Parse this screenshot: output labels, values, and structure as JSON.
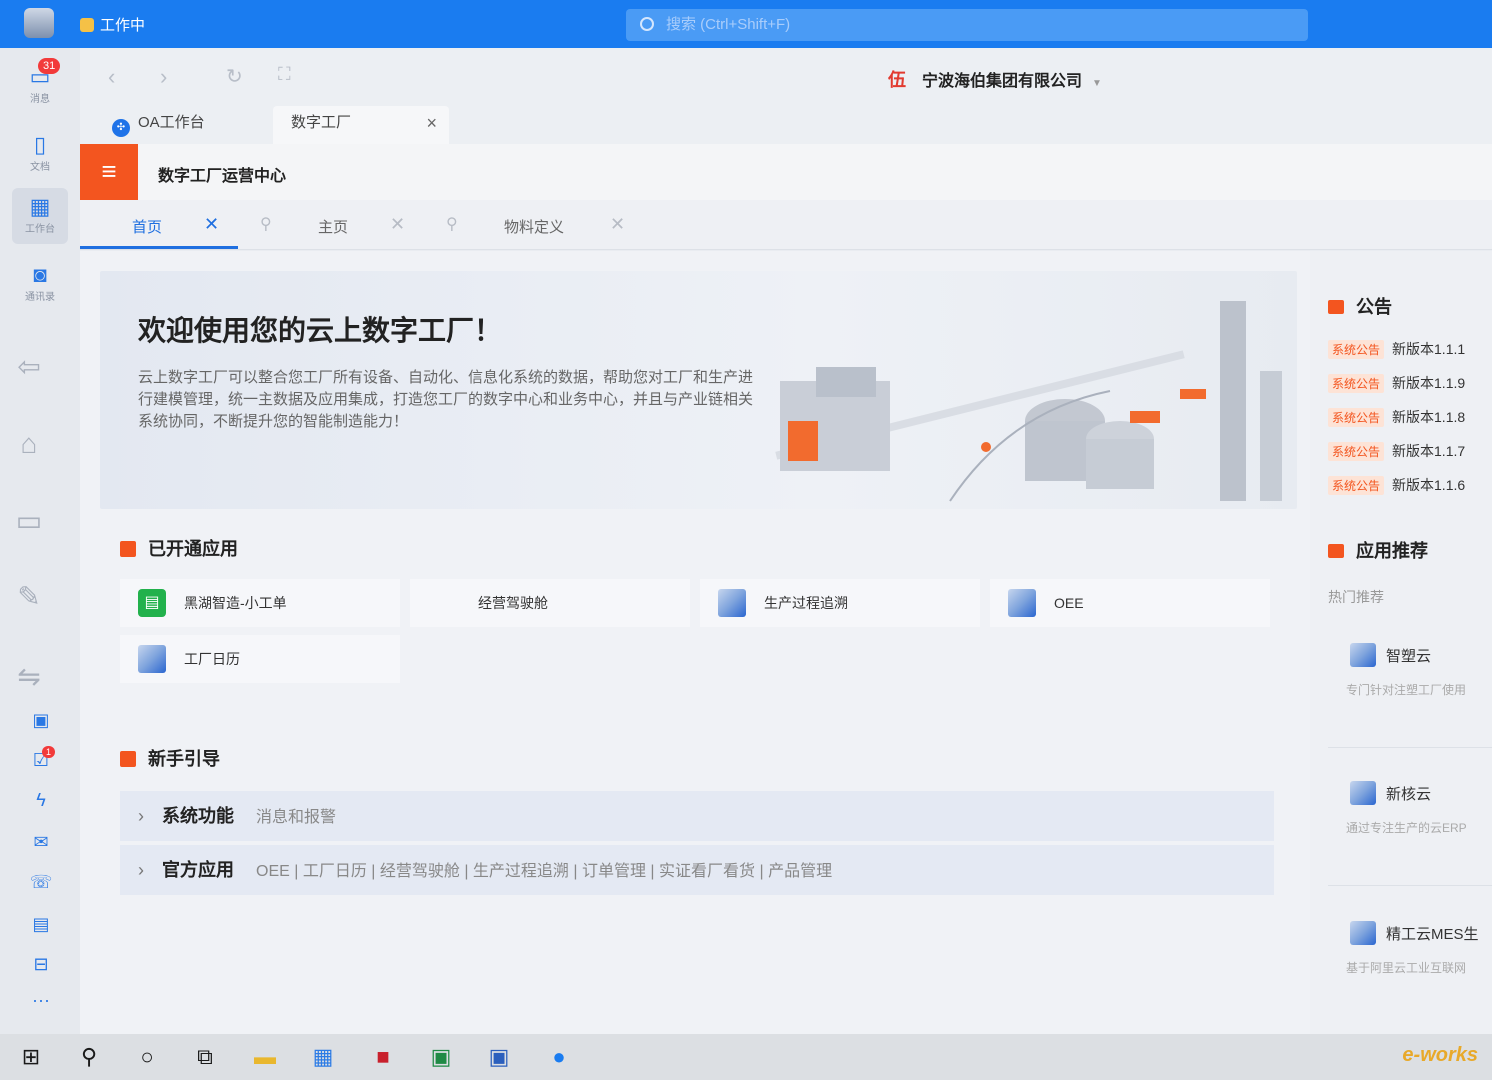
{
  "titlebar": {
    "status": "工作中",
    "search_placeholder": "搜索 (Ctrl+Shift+F)"
  },
  "rail": {
    "items": [
      {
        "label": "消息",
        "badge": "31"
      },
      {
        "label": "文档"
      },
      {
        "label": "工作台"
      },
      {
        "label": "通讯录"
      }
    ],
    "todo_badge": "1",
    "more": "···"
  },
  "navbar": {
    "company": "宁波海伯集团有限公司"
  },
  "apptabs": [
    {
      "label": "OA工作台"
    },
    {
      "label": "数字工厂"
    }
  ],
  "header": {
    "title": "数字工厂运营中心"
  },
  "pagetabs": [
    {
      "label": "首页"
    },
    {
      "label": "主页"
    },
    {
      "label": "物料定义"
    }
  ],
  "banner": {
    "title": "欢迎使用您的云上数字工厂！",
    "text": "云上数字工厂可以整合您工厂所有设备、自动化、信息化系统的数据，帮助您对工厂和生产进行建模管理，统一主数据及应用集成，打造您工厂的数字中心和业务中心，并且与产业链相关系统协同，不断提升您的智能制造能力！"
  },
  "apps": {
    "title": "已开通应用",
    "items": [
      "黑湖智造-小工单",
      "经营驾驶舱",
      "生产过程追溯",
      "OEE",
      "工厂日历"
    ]
  },
  "guide": {
    "title": "新手引导",
    "rows": [
      {
        "label": "系统功能",
        "sub": "消息和报警"
      },
      {
        "label": "官方应用",
        "sub": "OEE | 工厂日历 | 经营驾驶舱 | 生产过程追溯 | 订单管理 | 实证看厂看货 | 产品管理"
      }
    ]
  },
  "notices": {
    "title": "公告",
    "tag": "系统公告",
    "items": [
      "新版本1.1.1",
      "新版本1.1.9",
      "新版本1.1.8",
      "新版本1.1.7",
      "新版本1.1.6"
    ]
  },
  "recommend": {
    "title": "应用推荐",
    "hot": "热门推荐",
    "items": [
      {
        "name": "智塑云",
        "desc": "专门针对注塑工厂使用"
      },
      {
        "name": "新核云",
        "desc": "通过专注生产的云ERP"
      },
      {
        "name": "精工云MES生",
        "desc": "基于阿里云工业互联网"
      }
    ]
  },
  "watermark": "e-works"
}
